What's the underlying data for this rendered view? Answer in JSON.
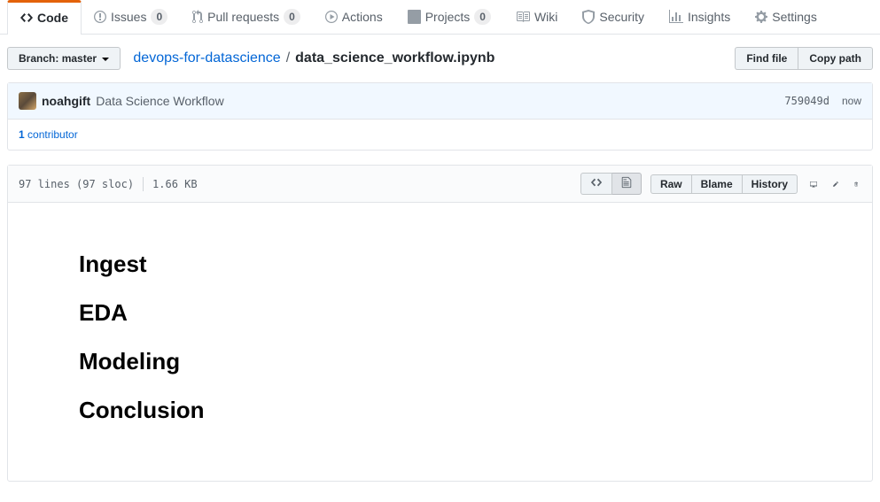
{
  "nav": {
    "code": "Code",
    "issues": "Issues",
    "issues_count": "0",
    "pulls": "Pull requests",
    "pulls_count": "0",
    "actions": "Actions",
    "projects": "Projects",
    "projects_count": "0",
    "wiki": "Wiki",
    "security": "Security",
    "insights": "Insights",
    "settings": "Settings"
  },
  "branch": {
    "label": "Branch:",
    "name": "master"
  },
  "breadcrumb": {
    "repo": "devops-for-datascience",
    "file": "data_science_workflow.ipynb"
  },
  "actions": {
    "find_file": "Find file",
    "copy_path": "Copy path"
  },
  "commit": {
    "author": "noahgift",
    "message": "Data Science Workflow",
    "sha": "759049d",
    "time": "now"
  },
  "contributors": {
    "count": "1",
    "label": "contributor"
  },
  "file": {
    "lines": "97 lines (97 sloc)",
    "size": "1.66 KB"
  },
  "toolbar": {
    "raw": "Raw",
    "blame": "Blame",
    "history": "History"
  },
  "content": {
    "h1": "Ingest",
    "h2": "EDA",
    "h3": "Modeling",
    "h4": "Conclusion"
  }
}
